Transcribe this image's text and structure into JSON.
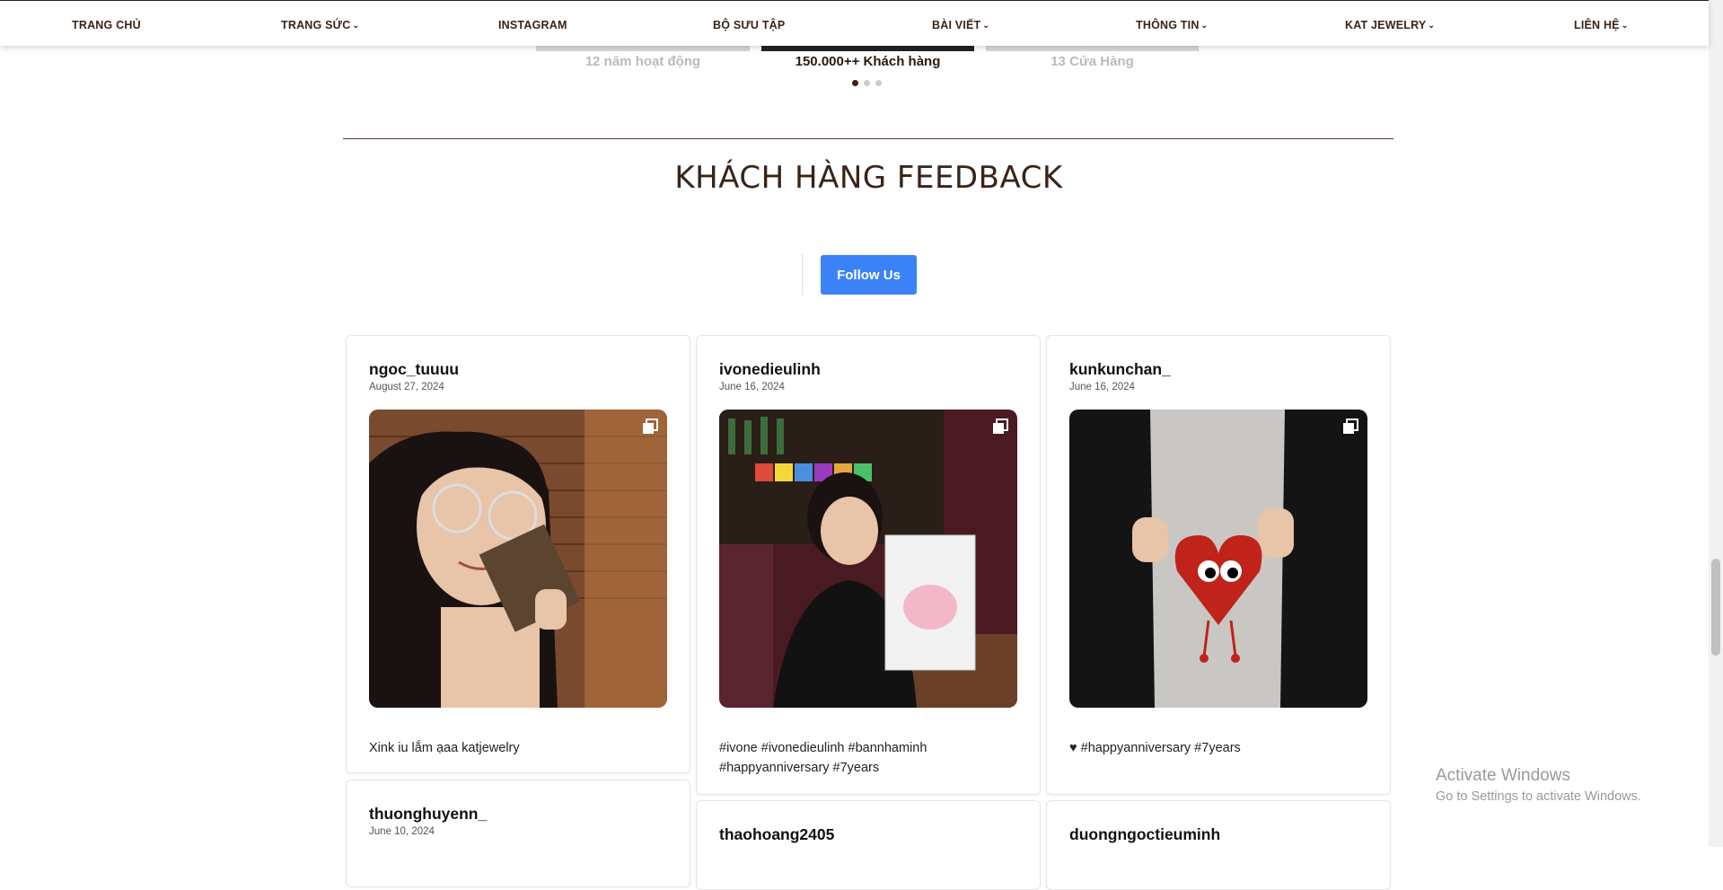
{
  "nav": {
    "items": [
      {
        "label": "TRANG CHỦ",
        "dropdown": false
      },
      {
        "label": "TRANG SỨC",
        "dropdown": true
      },
      {
        "label": "INSTAGRAM",
        "dropdown": false
      },
      {
        "label": "BỘ SƯU TẬP",
        "dropdown": false
      },
      {
        "label": "BÀI VIẾT",
        "dropdown": true
      },
      {
        "label": "THÔNG TIN",
        "dropdown": true
      },
      {
        "label": "KAT JEWELRY",
        "dropdown": true
      },
      {
        "label": "LIÊN HỆ",
        "dropdown": true
      }
    ],
    "caret": "⌄"
  },
  "stats": {
    "items": [
      "12 năm hoạt động",
      "150.000++ Khách hàng",
      "13 Cửa Hàng"
    ],
    "active_index": 1,
    "dot_count": 3
  },
  "feedback": {
    "title": "KHÁCH HÀNG FEEDBACK",
    "follow_label": "Follow Us",
    "follow_color": "#3b82f6",
    "posts": [
      {
        "user": "ngoc_tuuuu",
        "date": "August 27, 2024",
        "caption": "Xink iu lắm ạaa katjewelry",
        "icon": "gallery-icon"
      },
      {
        "user": "ivonedieulinh",
        "date": "June 16, 2024",
        "caption": "#ivone #ivonedieulinh #bannhaminh #happyanniversary #7years",
        "icon": "gallery-icon"
      },
      {
        "user": "kunkunchan_",
        "date": "June 16, 2024",
        "caption": "♥ #happyanniversary #7years",
        "icon": "gallery-icon"
      },
      {
        "user": "thuonghuyenn_",
        "date": "June 10, 2024",
        "caption": "",
        "icon": "gallery-icon"
      },
      {
        "user": "thaohoang2405",
        "date": "",
        "caption": "",
        "icon": "gallery-icon"
      },
      {
        "user": "duongngoctieuminh",
        "date": "",
        "caption": "",
        "icon": "gallery-icon"
      }
    ]
  },
  "watermark": {
    "line1": "Activate Windows",
    "line2": "Go to Settings to activate Windows."
  },
  "colors": {
    "brand_brown": "#3a2416",
    "accent_blue": "#3b82f6"
  }
}
